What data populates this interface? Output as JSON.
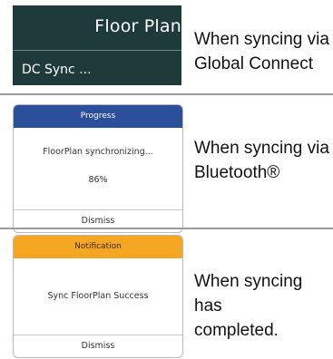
{
  "panel1": {
    "title": "Floor Plan",
    "status": "DC Sync ...",
    "caption_line1": "When syncing via",
    "caption_line2": "Global Connect"
  },
  "panel2": {
    "header": "Progress",
    "message": "FloorPlan synchronizing...",
    "percent": "86%",
    "button": "Dismiss",
    "header_color": "#2c4f9b",
    "caption_line1": "When syncing via",
    "caption_line2": "Bluetooth®"
  },
  "panel3": {
    "header": "Notification",
    "message": "Sync FloorPlan Success",
    "button": "Dismiss",
    "header_color": "#f5a623",
    "caption_line1": "When syncing has",
    "caption_line2": "completed."
  }
}
